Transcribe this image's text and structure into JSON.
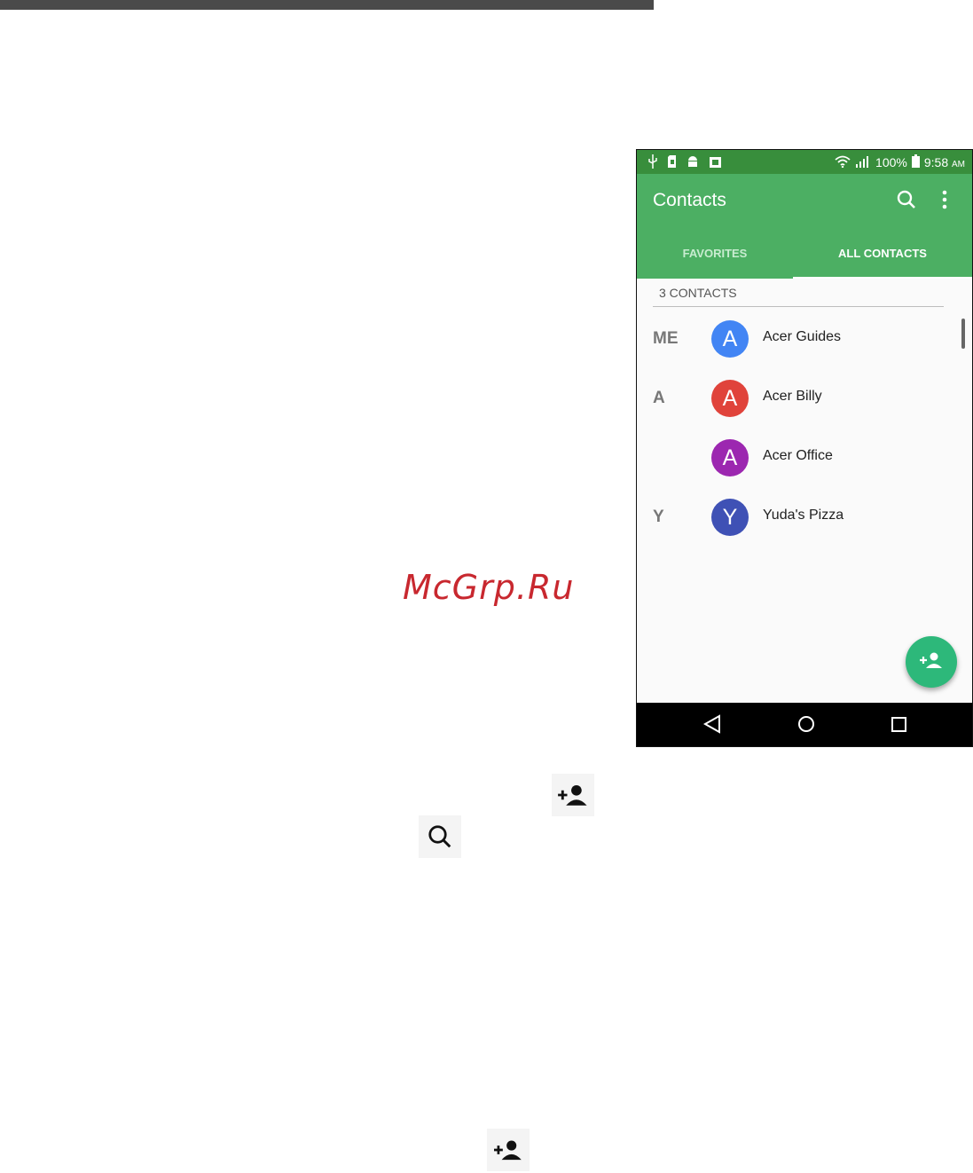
{
  "watermark": "McGrp.Ru",
  "statusbar": {
    "battery": "100%",
    "time": "9:58",
    "time_suffix": "AM"
  },
  "appbar": {
    "title": "Contacts"
  },
  "tabs": [
    {
      "label": "FAVORITES",
      "active": false
    },
    {
      "label": "ALL CONTACTS",
      "active": true
    }
  ],
  "contacts_count": "3 CONTACTS",
  "contacts": [
    {
      "section": "ME",
      "initial": "A",
      "name": "Acer Guides",
      "color": "#4285f4"
    },
    {
      "section": "A",
      "initial": "A",
      "name": "Acer Billy",
      "color": "#e0433b"
    },
    {
      "section": "",
      "initial": "A",
      "name": "Acer Office",
      "color": "#9c27b0"
    },
    {
      "section": "Y",
      "initial": "Y",
      "name": "Yuda's Pizza",
      "color": "#3f51b5"
    }
  ],
  "colors": {
    "accent": "#4caf63",
    "status": "#388e3c",
    "fab": "#2db87a"
  },
  "icons": [
    "search-icon",
    "more-vert-icon",
    "add-contact-icon",
    "back-icon",
    "home-icon",
    "recents-icon"
  ]
}
